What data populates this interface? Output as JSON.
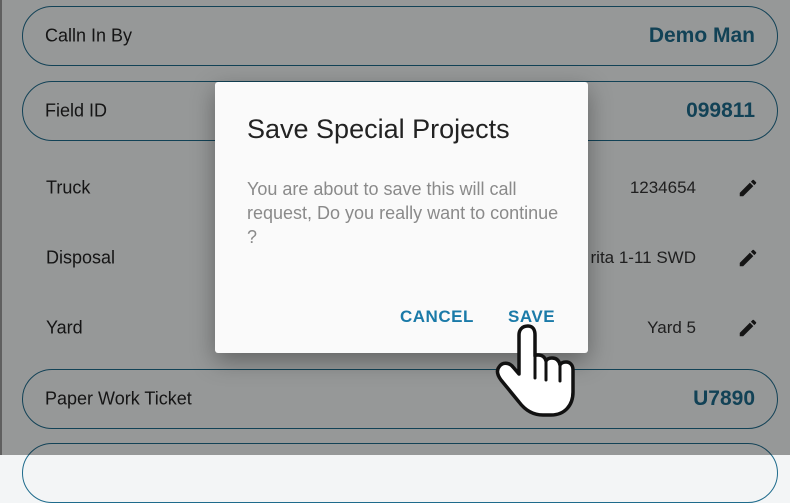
{
  "form": {
    "called_in_by": {
      "label": "Calln In By",
      "value": "Demo Man"
    },
    "field_id": {
      "label": "Field ID",
      "value": "099811"
    },
    "truck": {
      "label": "Truck",
      "value": "1234654"
    },
    "disposal": {
      "label": "Disposal",
      "value": "rita 1-11 SWD"
    },
    "yard": {
      "label": "Yard",
      "value": "Yard 5"
    },
    "paper_work_ticket": {
      "label": "Paper Work Ticket",
      "value": "U7890"
    }
  },
  "dialog": {
    "title": "Save Special Projects",
    "message": "You are about to save this will call request, Do you really want to continue ?",
    "cancel_label": "CANCEL",
    "save_label": "SAVE"
  },
  "icons": {
    "edit": "pencil-edit-icon",
    "cursor": "hand-pointer-cursor-icon"
  },
  "colors": {
    "accent": "#1e6b8c",
    "dialog_button": "#1a7aa8"
  }
}
